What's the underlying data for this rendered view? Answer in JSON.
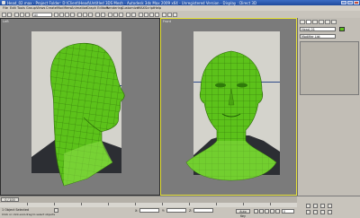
{
  "window": {
    "title": "Head_02.max   - Project Folder: D:\\Client\\Head\\Untitled 3DS Mesh    - Autodesk 3ds Max  2009 x64    - Unregistered Version    - Display : Direct 3D",
    "icons": [
      "minimize-icon",
      "maximize-icon",
      "close-icon"
    ]
  },
  "menu": [
    "File",
    "Edit",
    "Tools",
    "Group",
    "Views",
    "Create",
    "Modifiers",
    "Animation",
    "Graph Editors",
    "Rendering",
    "Customize",
    "MAXScript",
    "Help"
  ],
  "toolbar": {
    "selection_filter": "All"
  },
  "viewports": {
    "left_label": "Left",
    "right_label": "Front"
  },
  "command_panel": {
    "object_name": "Head_01",
    "modifier_list": "Modifier List",
    "object_color": "#5cc21a"
  },
  "status": {
    "frame_counter": "0 / 100",
    "selection_info": "1 Object Selected",
    "prompt": "Click or click-and-drag to select objects",
    "x_label": "X:",
    "y_label": "Y:",
    "z_label": "Z:",
    "auto_key": "Auto Key",
    "frame_field": "0"
  },
  "colors": {
    "mesh_green": "#5cc21a",
    "active_viewport_border": "#e6e23a",
    "viewport_bg": "#7b7b7b"
  }
}
